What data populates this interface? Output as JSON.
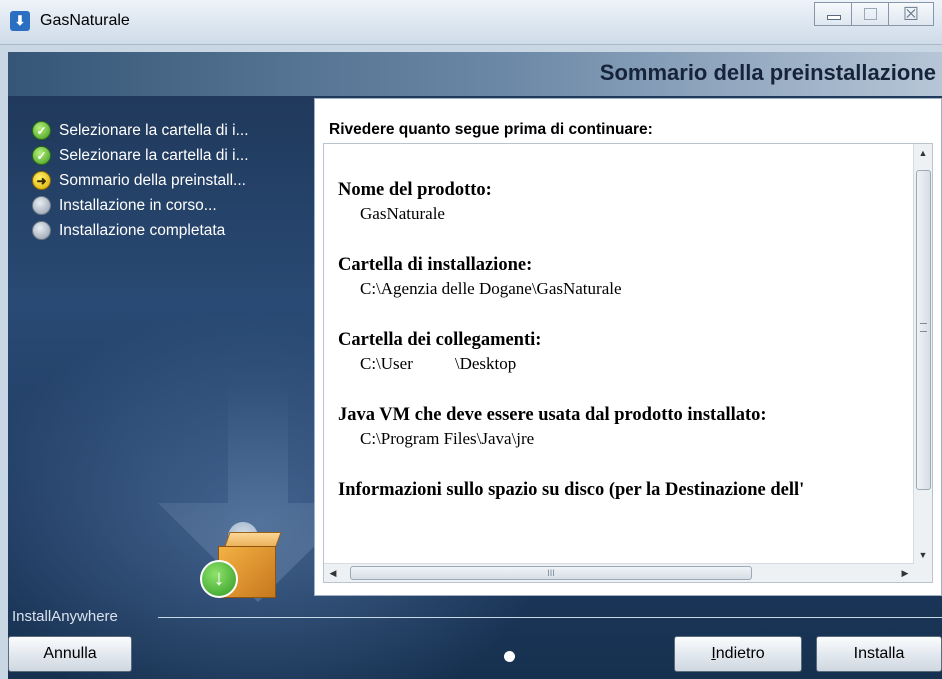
{
  "window": {
    "title": "GasNaturale",
    "controls": [
      "minimize",
      "maximize",
      "close"
    ],
    "close_glyph": "☒"
  },
  "header": {
    "title": "Sommario della preinstallazione"
  },
  "steps": [
    {
      "label": "Selezionare la cartella di i...",
      "state": "done",
      "icon": "check-icon"
    },
    {
      "label": "Selezionare la cartella di i...",
      "state": "done",
      "icon": "check-icon"
    },
    {
      "label": "Sommario della preinstall...",
      "state": "current",
      "icon": "arrow-right-icon"
    },
    {
      "label": "Installazione in corso...",
      "state": "pending",
      "icon": "circle-icon"
    },
    {
      "label": "Installazione completata",
      "state": "pending",
      "icon": "circle-icon"
    }
  ],
  "panel": {
    "heading": "Rivedere quanto segue prima di continuare:",
    "items": [
      {
        "label": "Nome del prodotto:",
        "value": "GasNaturale"
      },
      {
        "label": "Cartella di installazione:",
        "value": "C:\\Agenzia delle Dogane\\GasNaturale"
      },
      {
        "label": "Cartella dei collegamenti:",
        "value_part1": "C:\\User",
        "value_part2": "\\Desktop"
      },
      {
        "label": "Java VM che deve essere usata dal prodotto installato:",
        "value": "C:\\Program Files\\Java\\jre"
      },
      {
        "label": "Informazioni sullo spazio su disco (per la Destinazione dell'"
      }
    ],
    "hscroll_grip": "III"
  },
  "footer": {
    "brand": "InstallAnywhere",
    "cancel_label": "Annulla",
    "back_label": "Indietro",
    "install_label": "Installa"
  },
  "colors": {
    "header_text": "#17233a",
    "done": "#3e9a1f",
    "current": "#d9a800",
    "pending": "#8e9aa8",
    "background_dark": "#1f3a60"
  }
}
